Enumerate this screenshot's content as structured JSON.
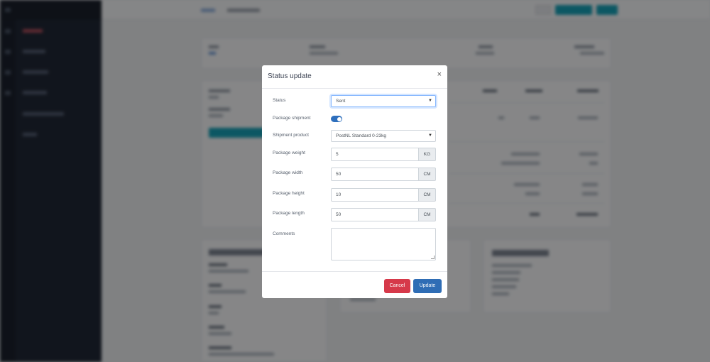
{
  "modal": {
    "title": "Status update",
    "close_glyph": "×",
    "fields": {
      "status": {
        "label": "Status",
        "value": "Sent"
      },
      "package_shipment": {
        "label": "Package shipment",
        "enabled": true
      },
      "shipment_product": {
        "label": "Shipment product",
        "value": "PostNL Standard 0-23kg"
      },
      "package_weight": {
        "label": "Package weight",
        "value": "5",
        "unit": "KG"
      },
      "package_width": {
        "label": "Package width",
        "value": "50",
        "unit": "CM"
      },
      "package_height": {
        "label": "Package height",
        "value": "10",
        "unit": "CM"
      },
      "package_length": {
        "label": "Package length",
        "value": "50",
        "unit": "CM"
      },
      "comments": {
        "label": "Comments",
        "value": ""
      }
    },
    "buttons": {
      "cancel": "Cancel",
      "update": "Update"
    }
  },
  "colors": {
    "sidebar": "#212836",
    "overlay": "#000000",
    "primary": "#2f6db5",
    "danger": "#d6394a",
    "teal": "#17a2b8",
    "focus": "#86b7fe"
  },
  "icons": {
    "close": "close-icon",
    "select_caret": "chevron-down-icon"
  }
}
